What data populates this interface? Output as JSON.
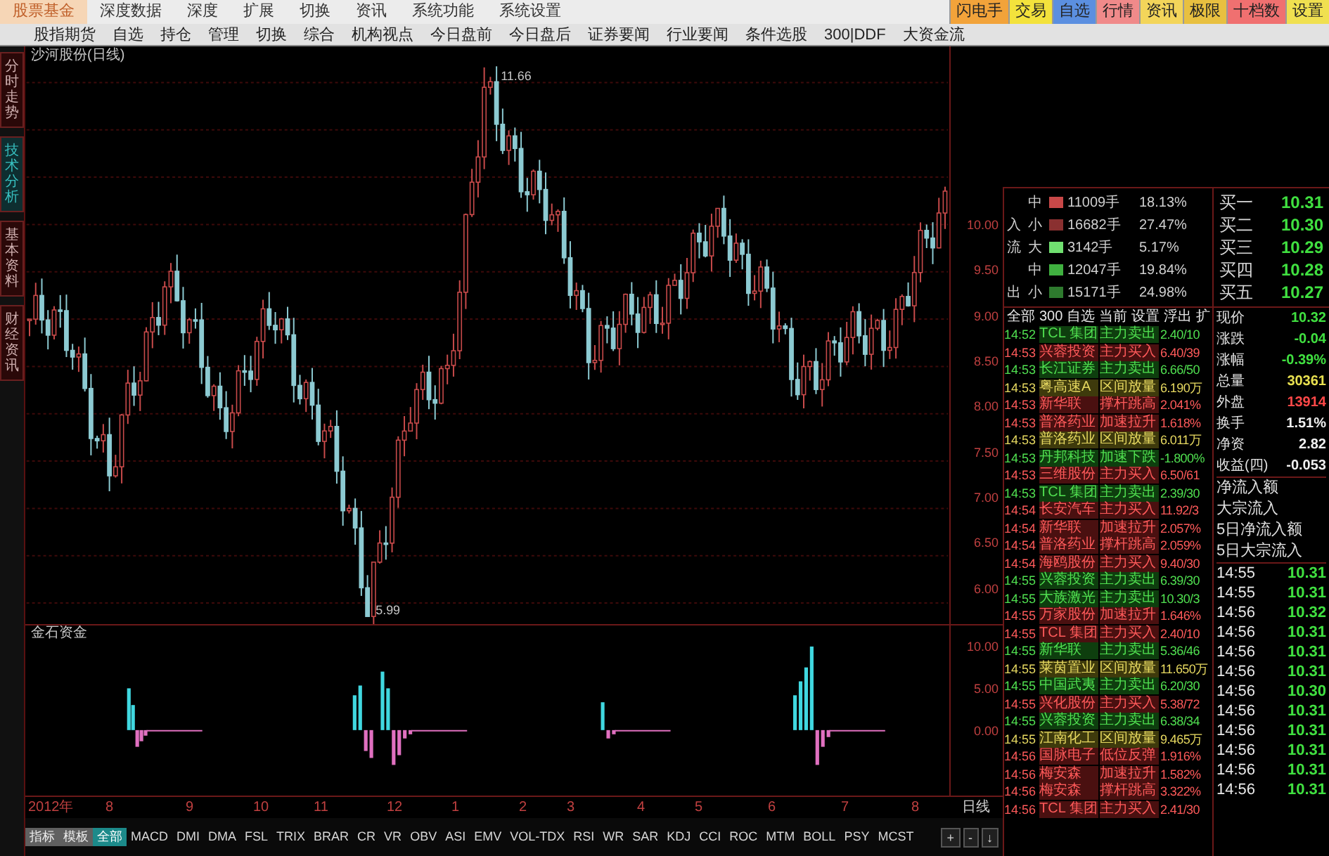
{
  "menu_bar": [
    {
      "label": "股票基金",
      "selected": true
    },
    {
      "label": "深度数据",
      "selected": false
    },
    {
      "label": "深度",
      "selected": false
    },
    {
      "label": "扩展",
      "selected": false
    },
    {
      "label": "切换",
      "selected": false
    },
    {
      "label": "资讯",
      "selected": false
    },
    {
      "label": "系统功能",
      "selected": false
    },
    {
      "label": "系统设置",
      "selected": false
    }
  ],
  "quick_buttons": [
    {
      "label": "闪电手",
      "color": "#f2a33a"
    },
    {
      "label": "交易",
      "color": "#f3e23c"
    },
    {
      "label": "自选",
      "color": "#5b8fe0"
    },
    {
      "label": "行情",
      "color": "#f08a8a"
    },
    {
      "label": "资讯",
      "color": "#f3d55a"
    },
    {
      "label": "极限",
      "color": "#e8c040"
    },
    {
      "label": "十档数",
      "color": "#f07070"
    },
    {
      "label": "设置",
      "color": "#f0e050"
    }
  ],
  "toolbar": [
    "股指期货",
    "自选",
    "持仓",
    "管理",
    "切换",
    "综合",
    "机构视点",
    "今日盘前",
    "今日盘后",
    "证券要闻",
    "行业要闻",
    "条件选股",
    "300|DDF",
    "大资金流"
  ],
  "side_tabs": [
    {
      "label": "分时走势",
      "selected": false
    },
    {
      "label": "技术分析",
      "selected": true
    },
    {
      "label": "基本资料",
      "selected": false
    },
    {
      "label": "财经资讯",
      "selected": false
    }
  ],
  "chart": {
    "title": "沙河股份(日线)",
    "high_label": "11.66",
    "low_label": "5.99",
    "price_ticks": [
      "10.00",
      "9.50",
      "9.00",
      "8.50",
      "8.00",
      "7.50",
      "7.00",
      "6.50",
      "6.00"
    ]
  },
  "indicator": {
    "title": "金石资金",
    "ticks": [
      "10.00",
      "5.00",
      "0.00"
    ]
  },
  "time_axis": [
    "2012年",
    "8",
    "9",
    "10",
    "11",
    "12",
    "1",
    "2",
    "3",
    "4",
    "5",
    "6",
    "7",
    "8"
  ],
  "period": "日线",
  "indicator_tabs": [
    {
      "label": "指标",
      "kind": "button",
      "selected": false
    },
    {
      "label": "模板",
      "kind": "button",
      "selected": false
    },
    {
      "label": "全部",
      "kind": "tab",
      "selected": true
    },
    {
      "label": "MACD",
      "kind": "tab",
      "selected": false
    },
    {
      "label": "DMI",
      "kind": "tab",
      "selected": false
    },
    {
      "label": "DMA",
      "kind": "tab",
      "selected": false
    },
    {
      "label": "FSL",
      "kind": "tab",
      "selected": false
    },
    {
      "label": "TRIX",
      "kind": "tab",
      "selected": false
    },
    {
      "label": "BRAR",
      "kind": "tab",
      "selected": false
    },
    {
      "label": "CR",
      "kind": "tab",
      "selected": false
    },
    {
      "label": "VR",
      "kind": "tab",
      "selected": false
    },
    {
      "label": "OBV",
      "kind": "tab",
      "selected": false
    },
    {
      "label": "ASI",
      "kind": "tab",
      "selected": false
    },
    {
      "label": "EMV",
      "kind": "tab",
      "selected": false
    },
    {
      "label": "VOL-TDX",
      "kind": "tab",
      "selected": false
    },
    {
      "label": "RSI",
      "kind": "tab",
      "selected": false
    },
    {
      "label": "WR",
      "kind": "tab",
      "selected": false
    },
    {
      "label": "SAR",
      "kind": "tab",
      "selected": false
    },
    {
      "label": "KDJ",
      "kind": "tab",
      "selected": false
    },
    {
      "label": "CCI",
      "kind": "tab",
      "selected": false
    },
    {
      "label": "ROC",
      "kind": "tab",
      "selected": false
    },
    {
      "label": "MTM",
      "kind": "tab",
      "selected": false
    },
    {
      "label": "BOLL",
      "kind": "tab",
      "selected": false
    },
    {
      "label": "PSY",
      "kind": "tab",
      "selected": false
    },
    {
      "label": "MCST",
      "kind": "tab",
      "selected": false
    }
  ],
  "zoom_buttons": [
    "+",
    "-",
    "↓"
  ],
  "money_flow": [
    {
      "size": "中",
      "amount": "11009手",
      "pct": "18.13%",
      "color": "#c84848"
    },
    {
      "side": "入",
      "size": "小",
      "amount": "16682手",
      "pct": "27.47%",
      "color": "#8a3030"
    },
    {
      "side": "流",
      "size": "大",
      "amount": "3142手",
      "pct": "5.17%",
      "color": "#70e070"
    },
    {
      "size": "中",
      "amount": "12047手",
      "pct": "19.84%",
      "color": "#40b040"
    },
    {
      "side": "出",
      "size": "小",
      "amount": "15171手",
      "pct": "24.98%",
      "color": "#2e7a2e"
    }
  ],
  "order_book": [
    {
      "label": "买一",
      "price": "10.31"
    },
    {
      "label": "买二",
      "price": "10.30"
    },
    {
      "label": "买三",
      "price": "10.29"
    },
    {
      "label": "买四",
      "price": "10.28"
    },
    {
      "label": "买五",
      "price": "10.27"
    }
  ],
  "alert_tabs": [
    "全部",
    "300",
    "自选",
    "当前",
    "设置",
    "浮出",
    "扩"
  ],
  "alerts": [
    {
      "time": "14:52",
      "stock": "TCL 集团",
      "event": "主力卖出",
      "value": "2.40/10",
      "kind": "down"
    },
    {
      "time": "14:53",
      "stock": "兴蓉投资",
      "event": "主力买入",
      "value": "6.40/39",
      "kind": "up"
    },
    {
      "time": "14:53",
      "stock": "长江证券",
      "event": "主力卖出",
      "value": "6.66/50",
      "kind": "down"
    },
    {
      "time": "14:53",
      "stock": "粤高速A",
      "event": "区间放量",
      "value": "6.190万",
      "kind": "volume"
    },
    {
      "time": "14:53",
      "stock": "新华联",
      "event": "撑杆跳高",
      "value": "2.041%",
      "kind": "up"
    },
    {
      "time": "14:53",
      "stock": "普洛药业",
      "event": "加速拉升",
      "value": "1.618%",
      "kind": "up"
    },
    {
      "time": "14:53",
      "stock": "普洛药业",
      "event": "区间放量",
      "value": "6.011万",
      "kind": "volume"
    },
    {
      "time": "14:53",
      "stock": "丹邦科技",
      "event": "加速下跌",
      "value": "-1.800%",
      "kind": "down"
    },
    {
      "time": "14:53",
      "stock": "三维股份",
      "event": "主力买入",
      "value": "6.50/61",
      "kind": "up"
    },
    {
      "time": "14:53",
      "stock": "TCL 集团",
      "event": "主力卖出",
      "value": "2.39/30",
      "kind": "down"
    },
    {
      "time": "14:54",
      "stock": "长安汽车",
      "event": "主力买入",
      "value": "11.92/3",
      "kind": "up"
    },
    {
      "time": "14:54",
      "stock": "新华联",
      "event": "加速拉升",
      "value": "2.057%",
      "kind": "up"
    },
    {
      "time": "14:54",
      "stock": "普洛药业",
      "event": "撑杆跳高",
      "value": "2.059%",
      "kind": "up"
    },
    {
      "time": "14:54",
      "stock": "海鸥股份",
      "event": "主力买入",
      "value": "9.40/30",
      "kind": "up"
    },
    {
      "time": "14:55",
      "stock": "兴蓉投资",
      "event": "主力卖出",
      "value": "6.39/30",
      "kind": "down"
    },
    {
      "time": "14:55",
      "stock": "大族激光",
      "event": "主力卖出",
      "value": "10.30/3",
      "kind": "down"
    },
    {
      "time": "14:55",
      "stock": "万家股份",
      "event": "加速拉升",
      "value": "1.646%",
      "kind": "up"
    },
    {
      "time": "14:55",
      "stock": "TCL 集团",
      "event": "主力买入",
      "value": "2.40/10",
      "kind": "up"
    },
    {
      "time": "14:55",
      "stock": "新华联",
      "event": "主力卖出",
      "value": "5.36/46",
      "kind": "down"
    },
    {
      "time": "14:55",
      "stock": "莱茵置业",
      "event": "区间放量",
      "value": "11.650万",
      "kind": "volume"
    },
    {
      "time": "14:55",
      "stock": "中国武夷",
      "event": "主力卖出",
      "value": "6.20/30",
      "kind": "down"
    },
    {
      "time": "14:55",
      "stock": "兴化股份",
      "event": "主力买入",
      "value": "5.38/72",
      "kind": "up"
    },
    {
      "time": "14:55",
      "stock": "兴蓉投资",
      "event": "主力卖出",
      "value": "6.38/34",
      "kind": "down"
    },
    {
      "time": "14:55",
      "stock": "江南化工",
      "event": "区间放量",
      "value": "9.465万",
      "kind": "volume"
    },
    {
      "time": "14:56",
      "stock": "国脉电子",
      "event": "低位反弹",
      "value": "1.916%",
      "kind": "up"
    },
    {
      "time": "14:56",
      "stock": "梅安森",
      "event": "加速拉升",
      "value": "1.582%",
      "kind": "up"
    },
    {
      "time": "14:56",
      "stock": "梅安森",
      "event": "撑杆跳高",
      "value": "3.322%",
      "kind": "up"
    },
    {
      "time": "14:56",
      "stock": "TCL 集团",
      "event": "主力买入",
      "value": "2.41/30",
      "kind": "up"
    }
  ],
  "quote": [
    {
      "label": "现价",
      "value": "10.32",
      "color": "#40e040"
    },
    {
      "label": "涨跌",
      "value": "-0.04",
      "color": "#40e040"
    },
    {
      "label": "涨幅",
      "value": "-0.39%",
      "color": "#40e040"
    },
    {
      "label": "总量",
      "value": "30361",
      "color": "#e8e050"
    },
    {
      "label": "外盘",
      "value": "13914",
      "color": "#ff4848"
    },
    {
      "label": "换手",
      "value": "1.51%",
      "color": "#f0f0f0"
    },
    {
      "label": "净资",
      "value": "2.82",
      "color": "#f0f0f0"
    },
    {
      "label": "收益(四)",
      "value": "-0.053",
      "color": "#f0f0f0"
    }
  ],
  "flow_labels": [
    "净流入额",
    "大宗流入",
    "5日净流入额",
    "5日大宗流入"
  ],
  "ticks": [
    {
      "time": "14:55",
      "price": "10.31"
    },
    {
      "time": "14:55",
      "price": "10.31"
    },
    {
      "time": "14:56",
      "price": "10.32"
    },
    {
      "time": "14:56",
      "price": "10.31"
    },
    {
      "time": "14:56",
      "price": "10.31"
    },
    {
      "time": "14:56",
      "price": "10.31"
    },
    {
      "time": "14:56",
      "price": "10.30"
    },
    {
      "time": "14:56",
      "price": "10.31"
    },
    {
      "time": "14:56",
      "price": "10.31"
    },
    {
      "time": "14:56",
      "price": "10.31"
    },
    {
      "time": "14:56",
      "price": "10.31"
    },
    {
      "time": "14:56",
      "price": "10.31"
    }
  ]
}
